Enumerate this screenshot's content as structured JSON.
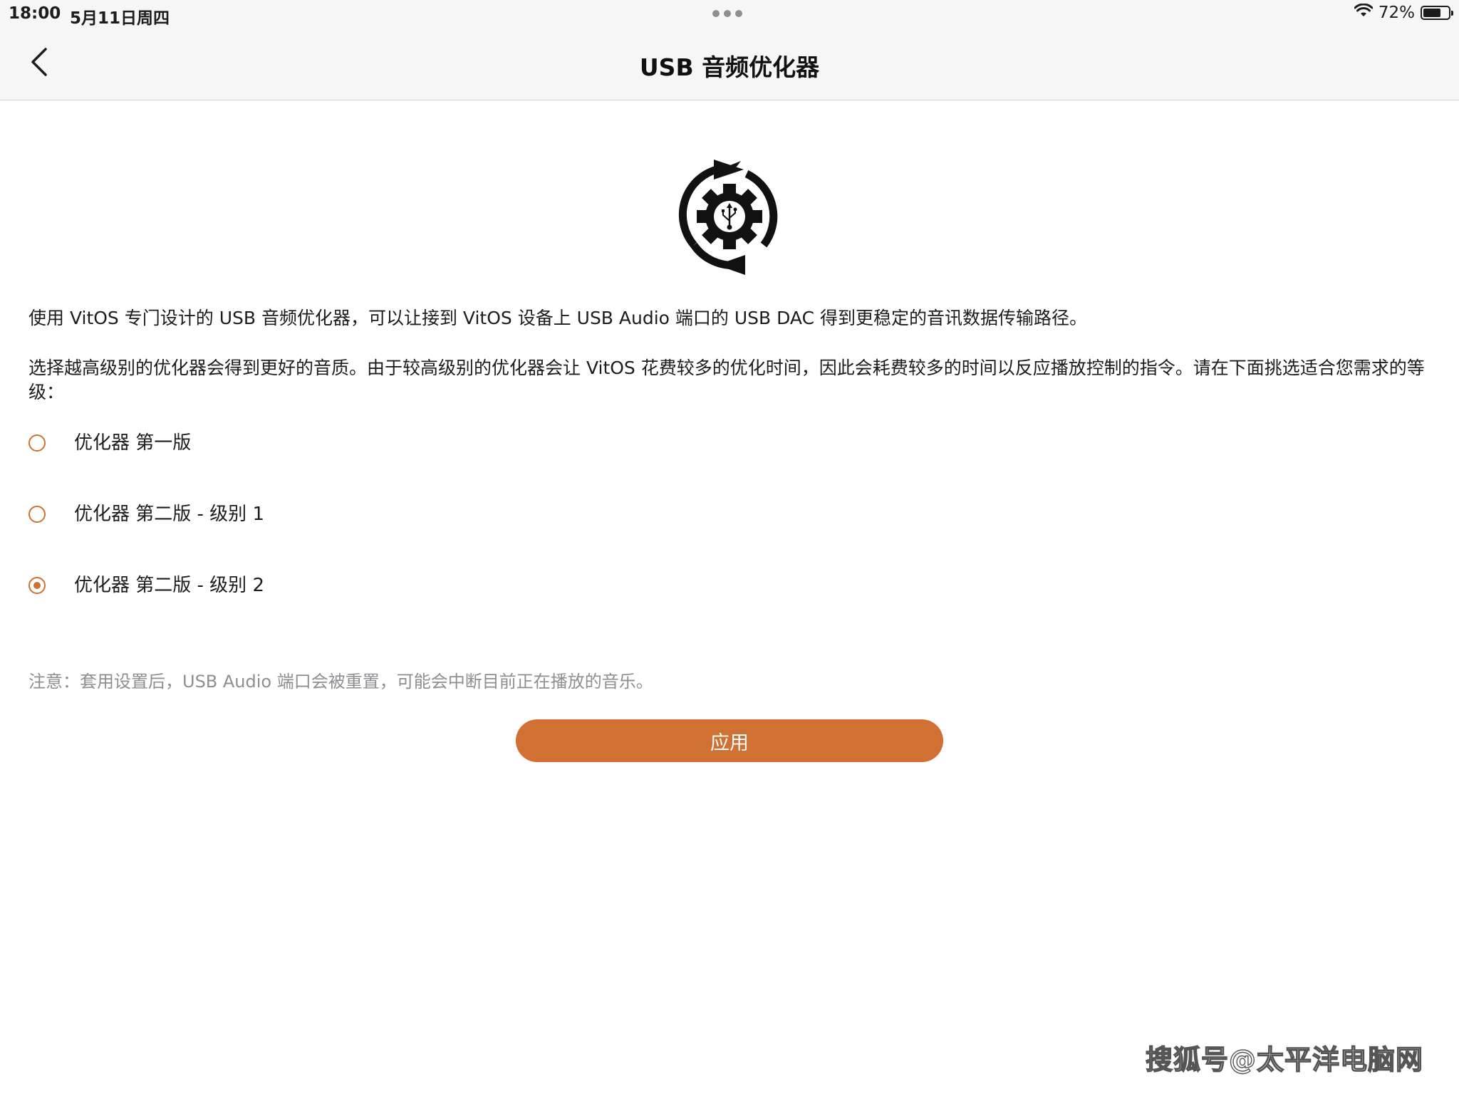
{
  "status_bar": {
    "time": "18:00",
    "date": "5月11日周四",
    "battery_percent_text": "72%",
    "battery_level": 0.72
  },
  "nav": {
    "title": "USB 音频优化器"
  },
  "description": {
    "paragraph_1": "使用 VitOS 专门设计的 USB 音频优化器，可以让接到 VitOS 设备上 USB Audio 端口的 USB DAC 得到更稳定的音讯数据传输路径。",
    "paragraph_2": "选择越高级别的优化器会得到更好的音质。由于较高级别的优化器会让 VitOS 花费较多的优化时间，因此会耗费较多的时间以反应播放控制的指令。请在下面挑选适合您需求的等级："
  },
  "options": [
    {
      "label": "优化器 第一版",
      "selected": false
    },
    {
      "label": "优化器 第二版 - 级别 1",
      "selected": false
    },
    {
      "label": "优化器 第二版 - 级别 2",
      "selected": true
    }
  ],
  "note": "注意：套用设置后，USB Audio 端口会被重置，可能会中断目前正在播放的音乐。",
  "apply_label": "应用",
  "watermark": "搜狐号@太平洋电脑网",
  "colors": {
    "accent": "#d07033",
    "nav_background": "#f6f6f6"
  }
}
